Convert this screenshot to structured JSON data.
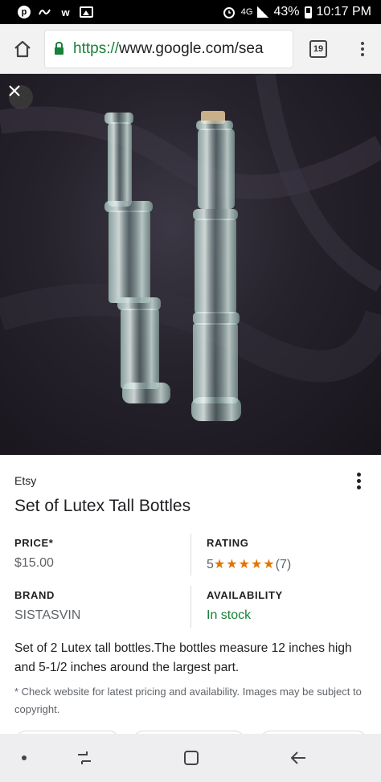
{
  "status_bar": {
    "notification_icons": [
      "pinterest-icon",
      "link-icon",
      "w-app-icon",
      "image-icon"
    ],
    "network": "4G",
    "battery": "43%",
    "time": "10:17 PM"
  },
  "browser": {
    "url_scheme": "https://",
    "url_rest": "www.google.com/sea",
    "tab_count": "19"
  },
  "product": {
    "merchant": "Etsy",
    "title": "Set of Lutex Tall Bottles",
    "price_label": "PRICE*",
    "price_value": "$15.00",
    "rating_label": "RATING",
    "rating_score": "5",
    "rating_stars": "★★★★★",
    "rating_count": "(7)",
    "brand_label": "BRAND",
    "brand_value": "SISTASVIN",
    "availability_label": "AVAILABILITY",
    "availability_value": "In stock",
    "description": "Set of 2 Lutex tall bottles.The bottles measure 12 inches high and 5-1/2 inches around the largest part.",
    "disclaimer": "* Check website for latest pricing and availability. Images may be subject to copyright."
  },
  "colors": {
    "accent_green": "#188038",
    "star_orange": "#e37400",
    "status_bar_bg": "#000000",
    "nav_bar_bg": "#eeeef0"
  },
  "nav_bar": {
    "icons": [
      "dot-icon",
      "recent-apps-icon",
      "home-square-icon",
      "back-arrow-icon"
    ]
  }
}
